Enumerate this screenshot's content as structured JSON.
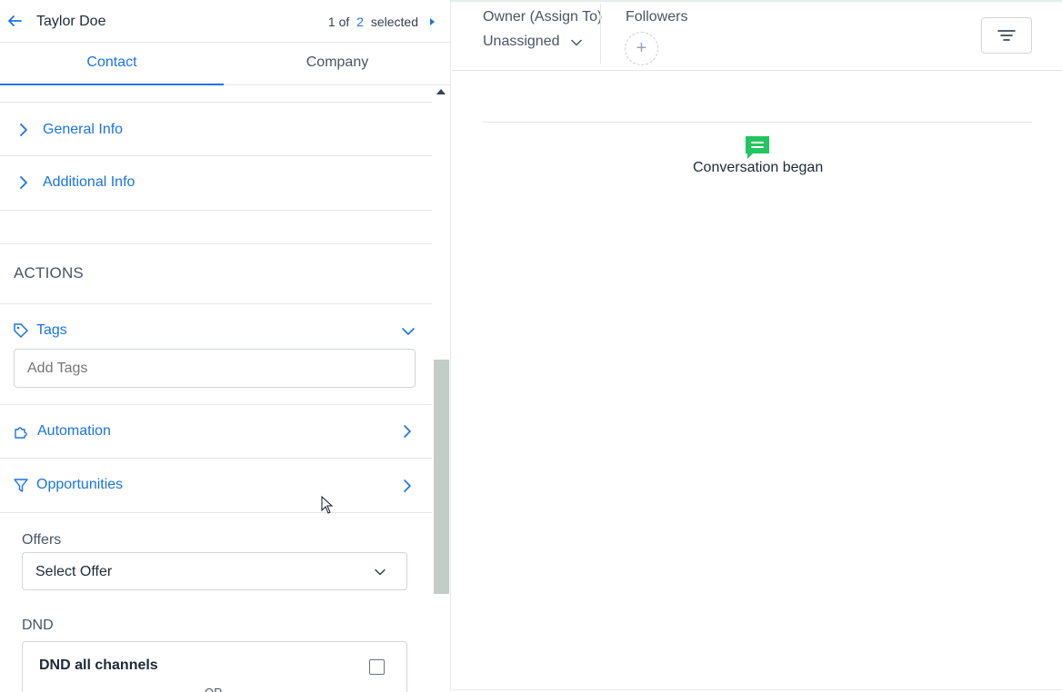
{
  "header": {
    "contact_name": "Taylor Doe",
    "pager_current": "1",
    "pager_of": "of",
    "pager_total": "2",
    "pager_selected": "selected"
  },
  "tabs": [
    {
      "label": "Contact",
      "active": true
    },
    {
      "label": "Company",
      "active": false
    }
  ],
  "sections": {
    "general_info": "General Info",
    "additional_info": "Additional Info"
  },
  "actions": {
    "heading": "ACTIONS",
    "tags_label": "Tags",
    "tags_placeholder": "Add Tags",
    "automation_label": "Automation",
    "opportunities_label": "Opportunities"
  },
  "offers": {
    "label": "Offers",
    "selected": "Select Offer"
  },
  "dnd": {
    "label": "DND",
    "all_channels": "DND all channels",
    "or": "OR",
    "checked": false
  },
  "right_header": {
    "owner_label": "Owner (Assign To)",
    "owner_value": "Unassigned",
    "followers_label": "Followers",
    "add_follower_glyph": "+"
  },
  "timeline": {
    "event": "Conversation began"
  },
  "colors": {
    "accent": "#1a73e8",
    "conversation_icon": "#22c55e",
    "scrollbar_thumb": "#c3ccc6"
  }
}
